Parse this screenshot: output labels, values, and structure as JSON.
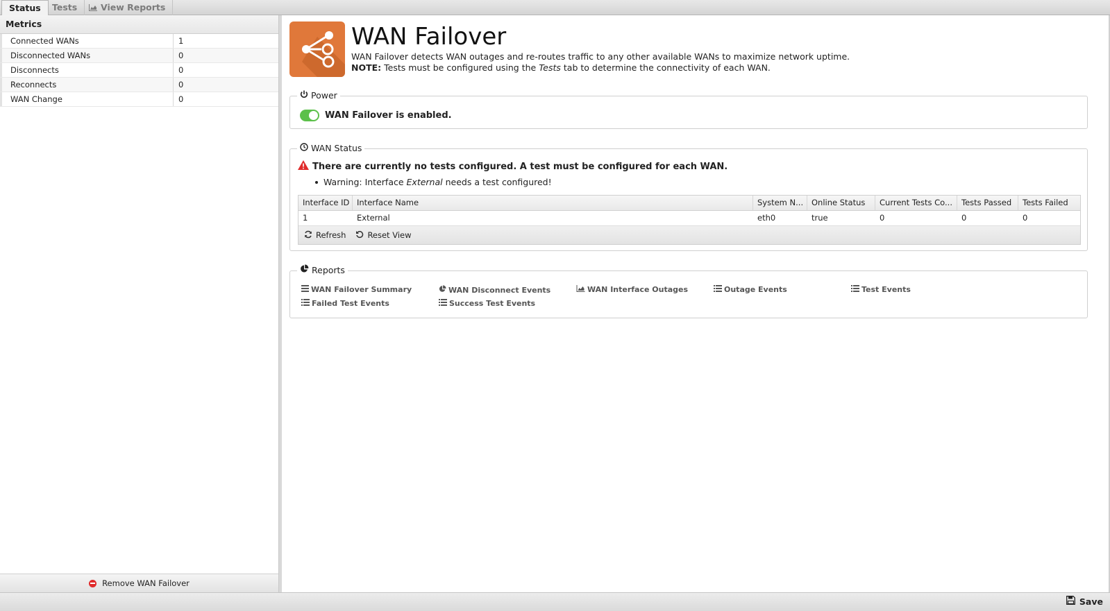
{
  "tabs": [
    {
      "label": "Status"
    },
    {
      "label": "Tests"
    },
    {
      "label": "View Reports"
    }
  ],
  "metrics": {
    "title": "Metrics",
    "rows": [
      {
        "name": "Connected WANs",
        "value": "1"
      },
      {
        "name": "Disconnected WANs",
        "value": "0"
      },
      {
        "name": "Disconnects",
        "value": "0"
      },
      {
        "name": "Reconnects",
        "value": "0"
      },
      {
        "name": "WAN Change",
        "value": "0"
      }
    ],
    "remove_label": "Remove WAN Failover"
  },
  "app": {
    "title": "WAN Failover",
    "description": "WAN Failover detects WAN outages and re-routes traffic to any other available WANs to maximize network uptime.",
    "note_label": "NOTE:",
    "note_pre": "Tests must be configured using the",
    "note_em": "Tests",
    "note_post": "tab to determine the connectivity of each WAN.",
    "accent_color": "#e0783a"
  },
  "power": {
    "legend": "Power",
    "status_text": "WAN Failover is enabled.",
    "enabled": true,
    "toggle_color": "#5cc04a"
  },
  "wan_status": {
    "legend": "WAN Status",
    "warning": "There are currently no tests configured. A test must be configured for each WAN.",
    "warning_item_pre": "Warning: Interface",
    "warning_item_em": "External",
    "warning_item_post": "needs a test configured!",
    "columns": [
      "Interface ID",
      "Interface Name",
      "System N...",
      "Online Status",
      "Current Tests Co...",
      "Tests Passed",
      "Tests Failed"
    ],
    "rows": [
      [
        "1",
        "External",
        "eth0",
        "true",
        "0",
        "0",
        "0"
      ]
    ],
    "refresh_label": "Refresh",
    "reset_label": "Reset View"
  },
  "reports": {
    "legend": "Reports",
    "links": [
      {
        "label": "WAN Failover Summary",
        "icon": "list-icon"
      },
      {
        "label": "WAN Disconnect Events",
        "icon": "pie-chart-icon"
      },
      {
        "label": "WAN Interface Outages",
        "icon": "area-chart-icon"
      },
      {
        "label": "Outage Events",
        "icon": "list-icon"
      },
      {
        "label": "Test Events",
        "icon": "list-icon"
      },
      {
        "label": "Failed Test Events",
        "icon": "list-icon"
      },
      {
        "label": "Success Test Events",
        "icon": "list-icon"
      }
    ]
  },
  "footer": {
    "save_label": "Save"
  }
}
